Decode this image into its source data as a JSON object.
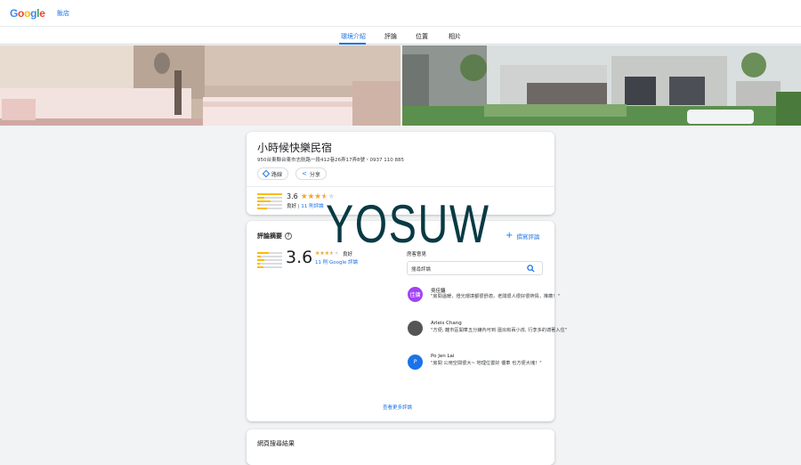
{
  "header": {
    "logo_letters": [
      {
        "ch": "G",
        "color": "#4285f4"
      },
      {
        "ch": "o",
        "color": "#ea4335"
      },
      {
        "ch": "o",
        "color": "#fbbc05"
      },
      {
        "ch": "g",
        "color": "#4285f4"
      },
      {
        "ch": "l",
        "color": "#34a853"
      },
      {
        "ch": "e",
        "color": "#ea4335"
      }
    ],
    "hotels_link": "飯店"
  },
  "tabs": [
    {
      "label": "環境介紹",
      "active": true
    },
    {
      "label": "評論",
      "active": false
    },
    {
      "label": "位置",
      "active": false
    },
    {
      "label": "相片",
      "active": false
    }
  ],
  "place": {
    "name": "小時候快樂民宿",
    "address": "950台東縣台東市志航路一段412巷26弄17弄8號・0937 110 885",
    "directions_label": "路線",
    "share_label": "分享",
    "rating": "3.6",
    "rating_fraction": 0.72,
    "rating_text": "良好",
    "review_count": "11 則評論"
  },
  "summary": {
    "title": "評論摘要",
    "help_icon": "?",
    "write_review": "撰寫評論",
    "rating": "3.6",
    "rating_fraction": 0.72,
    "rating_text": "良好",
    "google_reviews": "11 則 Google 評論",
    "bar_fractions": [
      0.45,
      0.15,
      0.3,
      0.1,
      0.25
    ],
    "guest_label": "房客意見",
    "search_placeholder": "搜尋評論",
    "reviews": [
      {
        "name": "吳佳鏞",
        "avatar_letter": "佳鏞",
        "avatar_color": "#a142f4",
        "text": "\"房間溫暖，燈光環境都很舒適，老闆很人很好很熱情，推薦！\""
      },
      {
        "name": "Arleis Chang",
        "avatar_letter": "",
        "avatar_color": "#555555",
        "text": "\"方便, 離市區開車五分鐘內可到 還出有兩小孩, 行李多的適著入住\""
      },
      {
        "name": "Po Jen Lai",
        "avatar_letter": "P",
        "avatar_color": "#1a73e8",
        "text": "\"房間 公用空間很大~ 地理位置好 優車 也方便大塊！\""
      }
    ],
    "more_reviews": "查看更多評論"
  },
  "web_results": {
    "title": "網頁搜尋結果"
  },
  "watermark": "YOSUW"
}
